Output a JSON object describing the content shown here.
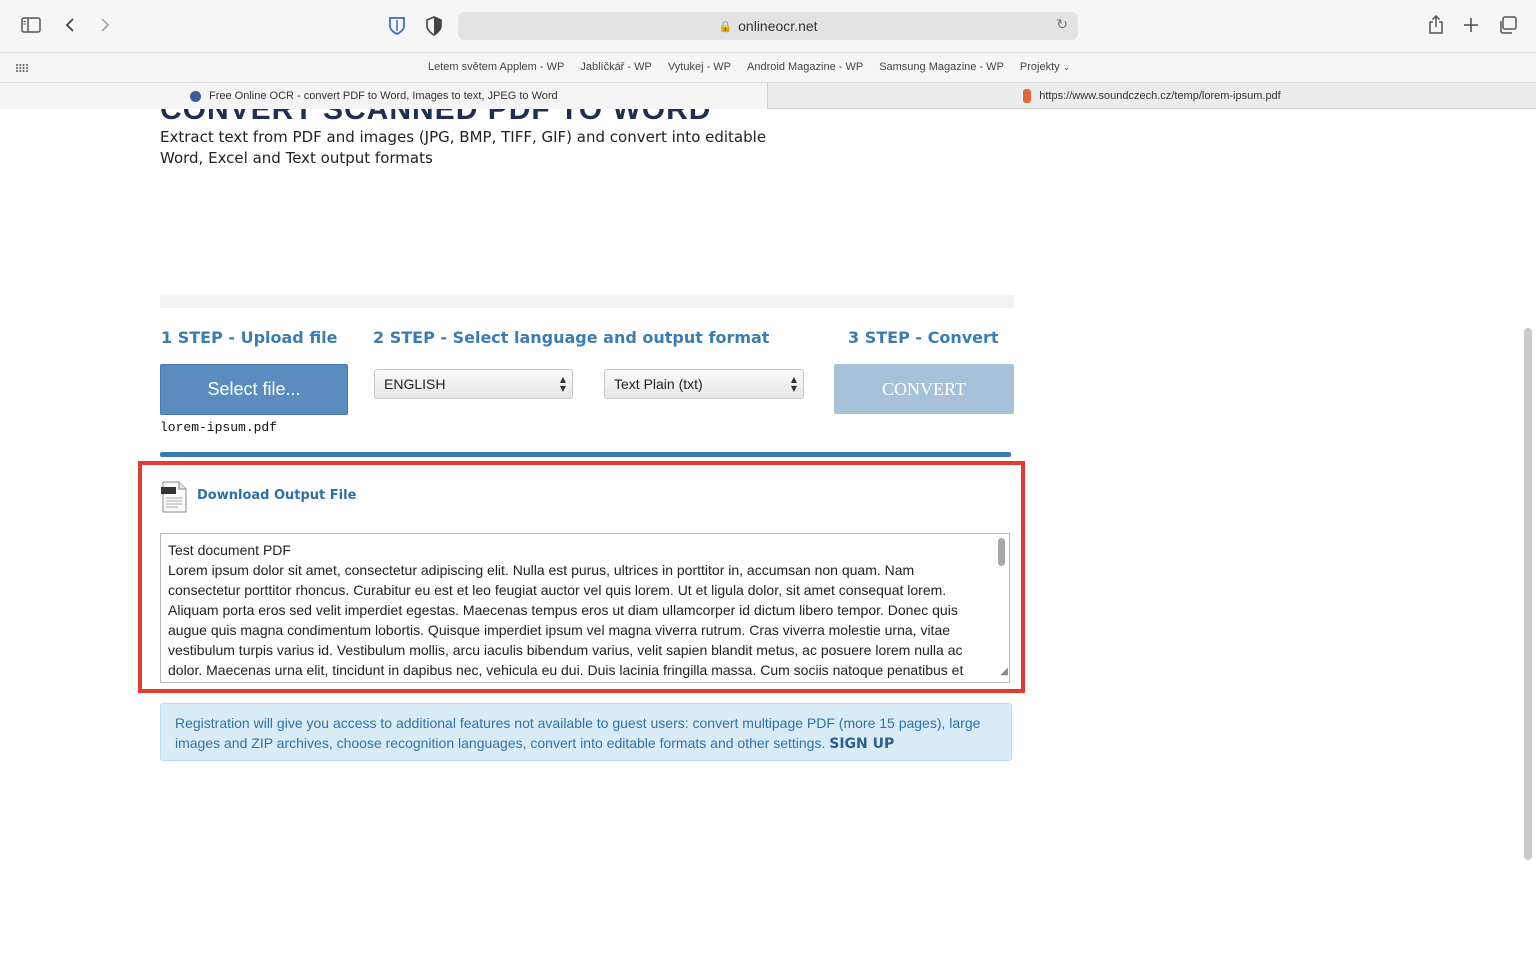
{
  "browser": {
    "url": "onlineocr.net",
    "favorites": [
      "Letem světem Applem - WP",
      "Jablíčkář - WP",
      "Vytukej - WP",
      "Android Magazine - WP",
      "Samsung Magazine - WP",
      "Projekty"
    ],
    "tabs": [
      {
        "title": "Free Online OCR - convert PDF to Word, Images to text, JPEG to Word",
        "icon_color": "#3b5b9a"
      },
      {
        "title": "https://www.soundczech.cz/temp/lorem-ipsum.pdf",
        "icon_color": "#e2663a"
      }
    ]
  },
  "page": {
    "hero_title": "CONVERT SCANNED PDF TO WORD",
    "subtitle": "Extract text from PDF and images (JPG, BMP, TIFF, GIF) and convert into editable Word, Excel and Text output formats",
    "steps": {
      "step1": "1 STEP - Upload file",
      "step2": "2 STEP - Select language and output format",
      "step3": "3 STEP - Convert"
    },
    "select_file_label": "Select file...",
    "selected_file": "lorem-ipsum.pdf",
    "language": "ENGLISH",
    "output_format": "Text Plain (txt)",
    "convert_label": "CONVERT",
    "download_label": "Download Output File",
    "output_lines": [
      "Test document PDF",
      "Lorem ipsum dolor sit amet, consectetur adipiscing elit. Nulla est purus, ultrices in porttitor in, accumsan non quam. Nam",
      "consectetur porttitor rhoncus. Curabitur eu est et leo feugiat auctor vel quis lorem. Ut et ligula dolor, sit amet consequat lorem.",
      "Aliquam porta eros sed velit imperdiet egestas. Maecenas tempus eros ut diam ullamcorper id dictum libero tempor. Donec quis",
      "augue quis magna condimentum lobortis. Quisque imperdiet ipsum vel magna viverra rutrum. Cras viverra molestie urna, vitae",
      "vestibulum turpis varius id. Vestibulum mollis, arcu iaculis bibendum varius, velit sapien blandit metus, ac posuere lorem nulla ac",
      "dolor. Maecenas urna elit, tincidunt in dapibus nec, vehicula eu dui. Duis lacinia fringilla massa. Cum sociis natoque penatibus et"
    ],
    "registration_text": "Registration will give you access to additional features not available to guest users: convert multipage PDF (more 15 pages), large images and ZIP archives, choose recognition languages, convert into editable formats and other settings.",
    "signup_label": "SIGN UP",
    "highlight_color": "#e53b2e"
  },
  "icons": {
    "sidebar": "sidebar-icon",
    "back": "chevron-left-icon",
    "forward": "chevron-right-icon",
    "bitwarden": "bitwarden-shield-icon",
    "privacy": "privacy-shield-icon",
    "reload": "reload-icon",
    "share": "share-icon",
    "new_tab": "plus-icon",
    "tabs_overview": "tabs-overview-icon",
    "grid": "grid-icon",
    "document": "txt-document-icon"
  }
}
